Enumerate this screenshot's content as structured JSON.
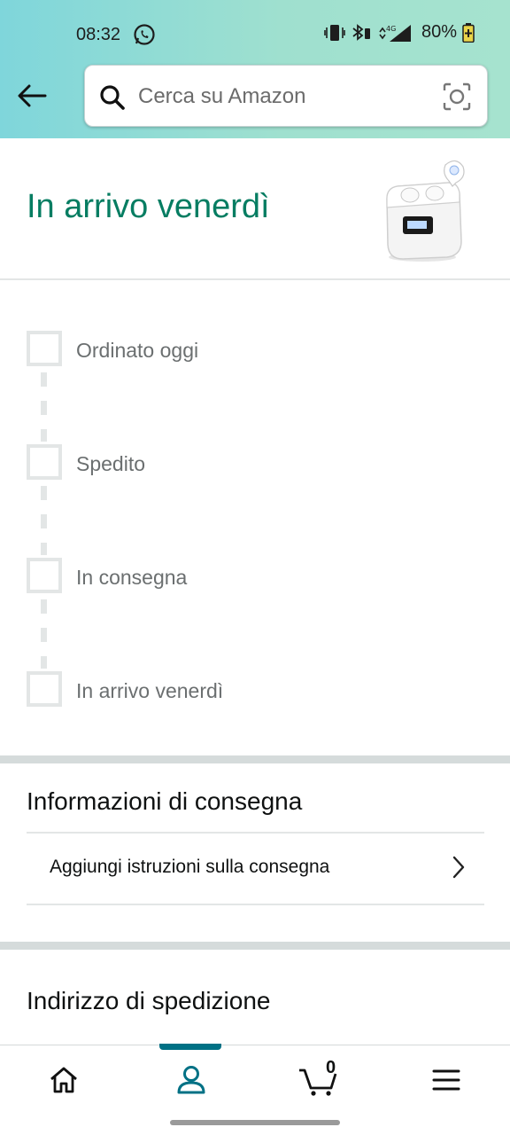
{
  "status_bar": {
    "time": "08:32",
    "battery": "80%",
    "network": "4G"
  },
  "search": {
    "placeholder": "Cerca su Amazon"
  },
  "arrival": {
    "title": "In arrivo venerdì"
  },
  "tracker": {
    "steps": [
      {
        "label": "Ordinato oggi"
      },
      {
        "label": "Spedito"
      },
      {
        "label": "In consegna"
      },
      {
        "label": "In arrivo venerdì"
      }
    ]
  },
  "delivery_info": {
    "heading": "Informazioni di consegna",
    "add_instructions": "Aggiungi istruzioni sulla consegna"
  },
  "shipping": {
    "heading": "Indirizzo di spedizione"
  },
  "tab_bar": {
    "cart_count": "0",
    "tabs": [
      "home-icon",
      "account-icon",
      "cart-icon",
      "menu-icon"
    ]
  },
  "colors": {
    "accent_green": "#067d62",
    "tab_indicator": "#007185",
    "header_gradient_start": "#7fd6db",
    "header_gradient_end": "#a6e3cf"
  }
}
